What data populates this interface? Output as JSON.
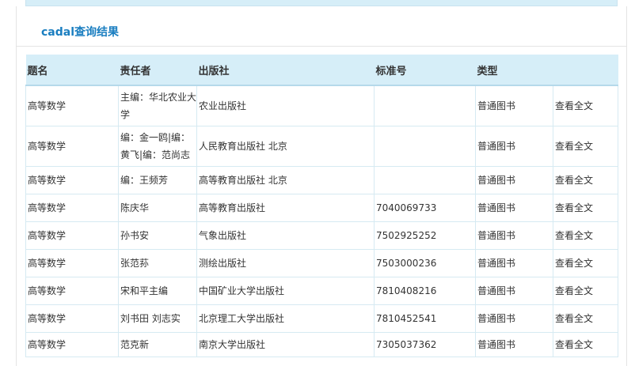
{
  "section": {
    "title": "cadal查询结果"
  },
  "table": {
    "headers": [
      "题名",
      "责任者",
      "出版社",
      "标准号",
      "类型",
      ""
    ],
    "rows": [
      {
        "title": "高等数学",
        "author": "主编：华北农业大学",
        "publisher": "农业出版社",
        "isbn": "",
        "type": "普通图书",
        "action": "查看全文"
      },
      {
        "title": "高等数学",
        "author": "编：金一鸥|编：黄飞|编：范尚志",
        "publisher": "人民教育出版社 北京",
        "isbn": "",
        "type": "普通图书",
        "action": "查看全文"
      },
      {
        "title": "高等数学",
        "author": "编：王频芳",
        "publisher": "高等教育出版社 北京",
        "isbn": "",
        "type": "普通图书",
        "action": "查看全文"
      },
      {
        "title": "高等数学",
        "author": "陈庆华",
        "publisher": "高等教育出版社",
        "isbn": "7040069733",
        "type": "普通图书",
        "action": "查看全文"
      },
      {
        "title": "高等数学",
        "author": "孙书安",
        "publisher": "气象出版社",
        "isbn": "7502925252",
        "type": "普通图书",
        "action": "查看全文"
      },
      {
        "title": "高等数学",
        "author": "张范荪",
        "publisher": "测绘出版社",
        "isbn": "7503000236",
        "type": "普通图书",
        "action": "查看全文"
      },
      {
        "title": "高等数学",
        "author": "宋和平主编",
        "publisher": "中国矿业大学出版社",
        "isbn": "7810408216",
        "type": "普通图书",
        "action": "查看全文"
      },
      {
        "title": "高等数学",
        "author": "刘书田 刘志实",
        "publisher": "北京理工大学出版社",
        "isbn": "7810452541",
        "type": "普通图书",
        "action": "查看全文"
      },
      {
        "title": "高等数学",
        "author": "范克新",
        "publisher": "南京大学出版社",
        "isbn": "7305037362",
        "type": "普通图书",
        "action": "查看全文"
      }
    ]
  },
  "colors": {
    "accent": "#1a7ec0",
    "header_bg": "#d6eef8",
    "cell_border": "#d6eaf2"
  }
}
